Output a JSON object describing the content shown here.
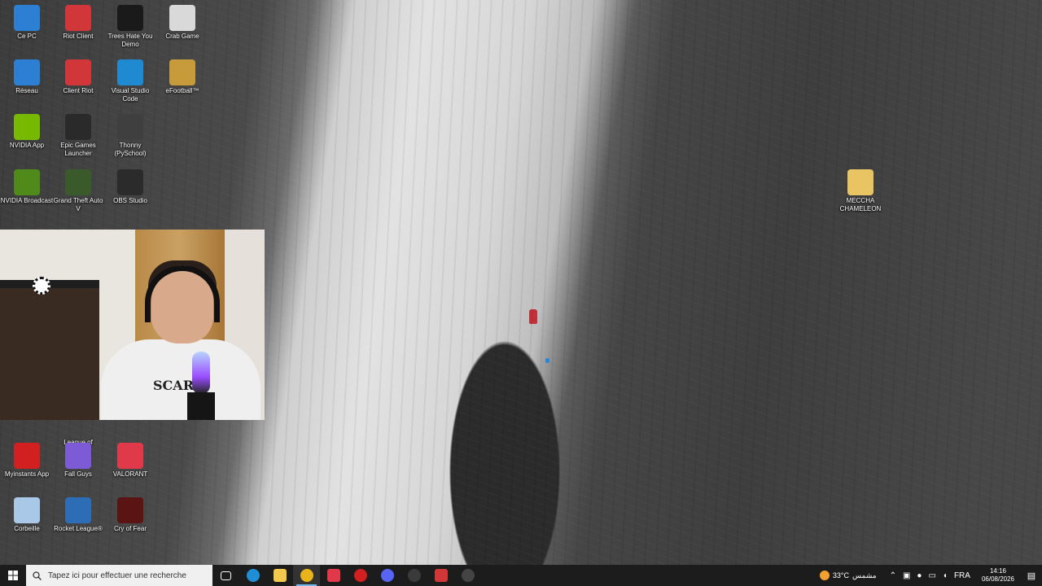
{
  "desktop": {
    "icons": [
      {
        "id": "ce-pc",
        "label": "Ce PC",
        "icon": "computer-icon",
        "color": "#2d7fd3"
      },
      {
        "id": "riot-client",
        "label": "Riot Client",
        "icon": "riot-icon",
        "color": "#d13639"
      },
      {
        "id": "trees-hate-you",
        "label": "Trees Hate You Demo",
        "icon": "tree-icon",
        "color": "#1a1a1a"
      },
      {
        "id": "crab-game",
        "label": "Crab Game",
        "icon": "crab-game-icon",
        "color": "#d9d9d9"
      },
      {
        "id": "reseau",
        "label": "Réseau",
        "icon": "network-icon",
        "color": "#2d7fd3"
      },
      {
        "id": "client-riot",
        "label": "Client Riot",
        "icon": "riot-icon",
        "color": "#d13639"
      },
      {
        "id": "vscode",
        "label": "Visual Studio Code",
        "icon": "vscode-icon",
        "color": "#1f8ad2"
      },
      {
        "id": "efootball",
        "label": "eFootball™",
        "icon": "efootball-icon",
        "color": "#c79b3a"
      },
      {
        "id": "nvidia-app",
        "label": "NVIDIA App",
        "icon": "nvidia-icon",
        "color": "#76b900"
      },
      {
        "id": "epic",
        "label": "Epic Games Launcher",
        "icon": "epic-icon",
        "color": "#2a2a2a"
      },
      {
        "id": "thonny",
        "label": "Thonny (PySchool)",
        "icon": "thonny-icon",
        "color": "#3f3f3f"
      },
      {
        "id": "nvidia-broadcast",
        "label": "NVIDIA Broadcast",
        "icon": "nvidia-broadcast-icon",
        "color": "#4f8a1a"
      },
      {
        "id": "gta",
        "label": "Grand Theft Auto V",
        "icon": "gta-icon",
        "color": "#3b5a2b"
      },
      {
        "id": "obs",
        "label": "OBS Studio",
        "icon": "obs-icon",
        "color": "#2b2b2b"
      },
      {
        "id": "league",
        "label": "League of Legends",
        "icon": "league-icon",
        "color": "#2c3e50"
      },
      {
        "id": "myinstants",
        "label": "Myinstants App",
        "icon": "myinstants-icon",
        "color": "#d21f1f"
      },
      {
        "id": "fall-guys",
        "label": "Fall Guys",
        "icon": "fall-guys-icon",
        "color": "#7e5bd6"
      },
      {
        "id": "valorant",
        "label": "VALORANT",
        "icon": "valorant-icon",
        "color": "#e0394a"
      },
      {
        "id": "corbeille",
        "label": "Corbeille",
        "icon": "recycle-bin-icon",
        "color": "#a9c7e6"
      },
      {
        "id": "rocket-league",
        "label": "Rocket League®",
        "icon": "rocket-league-icon",
        "color": "#2d6db5"
      },
      {
        "id": "cry-of-fear",
        "label": "Cry of Fear",
        "icon": "cry-of-fear-icon",
        "color": "#5a1414"
      },
      {
        "id": "meccha",
        "label": "MECCHA CHAMELEON",
        "icon": "folder-icon",
        "color": "#e8c463"
      }
    ]
  },
  "webcam": {
    "shirt_text": "SCARE"
  },
  "taskbar": {
    "search_placeholder": "Tapez ici pour effectuer une recherche",
    "apps": [
      {
        "id": "task-view",
        "icon": "task-view-icon",
        "color": "#ffffff"
      },
      {
        "id": "edge",
        "icon": "edge-icon",
        "color": "#1e8fd6"
      },
      {
        "id": "file-explorer",
        "icon": "folder-icon",
        "color": "#f2c94c"
      },
      {
        "id": "chrome",
        "icon": "chrome-icon",
        "color": "#e9b31c"
      },
      {
        "id": "valorant",
        "icon": "valorant-icon",
        "color": "#e0394a"
      },
      {
        "id": "myinstants",
        "icon": "myinstants-icon",
        "color": "#d21f1f"
      },
      {
        "id": "discord",
        "icon": "discord-icon",
        "color": "#5865f2"
      },
      {
        "id": "obs",
        "icon": "obs-icon",
        "color": "#3a3a3a"
      },
      {
        "id": "riot",
        "icon": "riot-icon",
        "color": "#d13639"
      },
      {
        "id": "media-player",
        "icon": "play-icon",
        "color": "#444444"
      }
    ],
    "weather": {
      "temp": "33°C",
      "condition": "مشمس"
    },
    "language": "FRA",
    "time": "14:16",
    "date": "06/08/2026"
  }
}
